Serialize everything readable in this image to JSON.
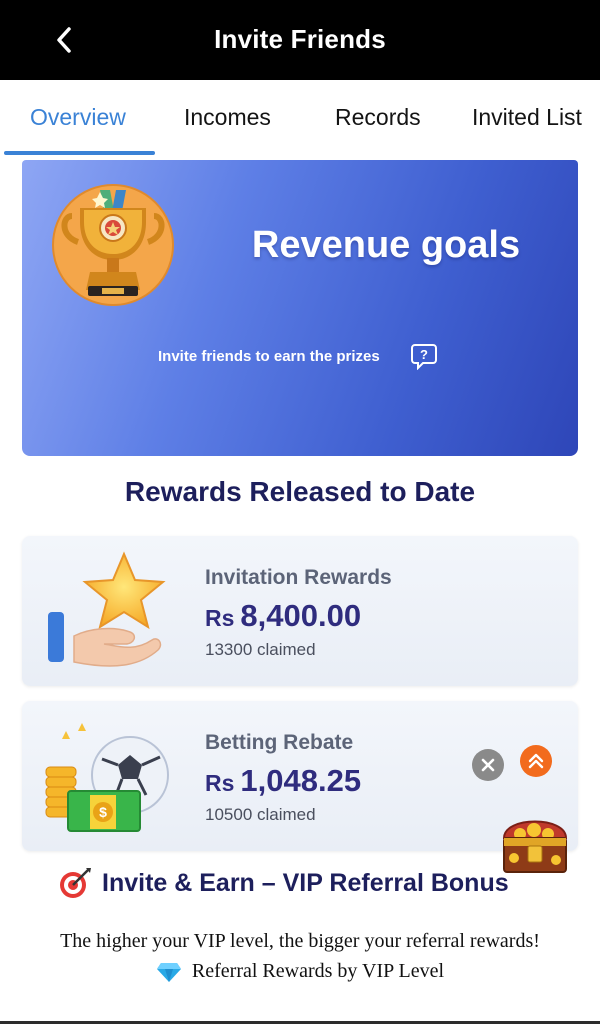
{
  "header": {
    "title": "Invite Friends",
    "back_icon": "chevron-left-icon"
  },
  "tabs": [
    {
      "label": "Overview",
      "active": true
    },
    {
      "label": "Incomes",
      "active": false
    },
    {
      "label": "Records",
      "active": false
    },
    {
      "label": "Invited List",
      "active": false
    }
  ],
  "banner": {
    "title": "Revenue goals",
    "subtitle": "Invite friends to earn the prizes",
    "icon": "trophy-icon",
    "help_icon": "question-bubble-icon"
  },
  "rewards": {
    "title": "Rewards Released to Date",
    "cards": [
      {
        "label": "Invitation Rewards",
        "currency": "Rs",
        "amount": "8,400.00",
        "claimed": "13300 claimed",
        "icon": "star-hand-icon"
      },
      {
        "label": "Betting Rebate",
        "currency": "Rs",
        "amount": "1,048.25",
        "claimed": "10500 claimed",
        "icon": "coins-ball-icon"
      }
    ]
  },
  "floating": {
    "close_icon": "close-icon",
    "scroll_top_icon": "double-chevron-up-icon",
    "chest_icon": "treasure-chest-icon"
  },
  "vip": {
    "title": "Invite & Earn – VIP Referral Bonus",
    "line1": "The higher your VIP level, the bigger your referral rewards!",
    "line2": "Referral Rewards by VIP Level"
  },
  "colors": {
    "accent": "#3a82d6",
    "header_bg": "#000000",
    "heading": "#1d1f5c",
    "amount": "#2f2c7e",
    "scroll_top": "#f26b1d"
  }
}
